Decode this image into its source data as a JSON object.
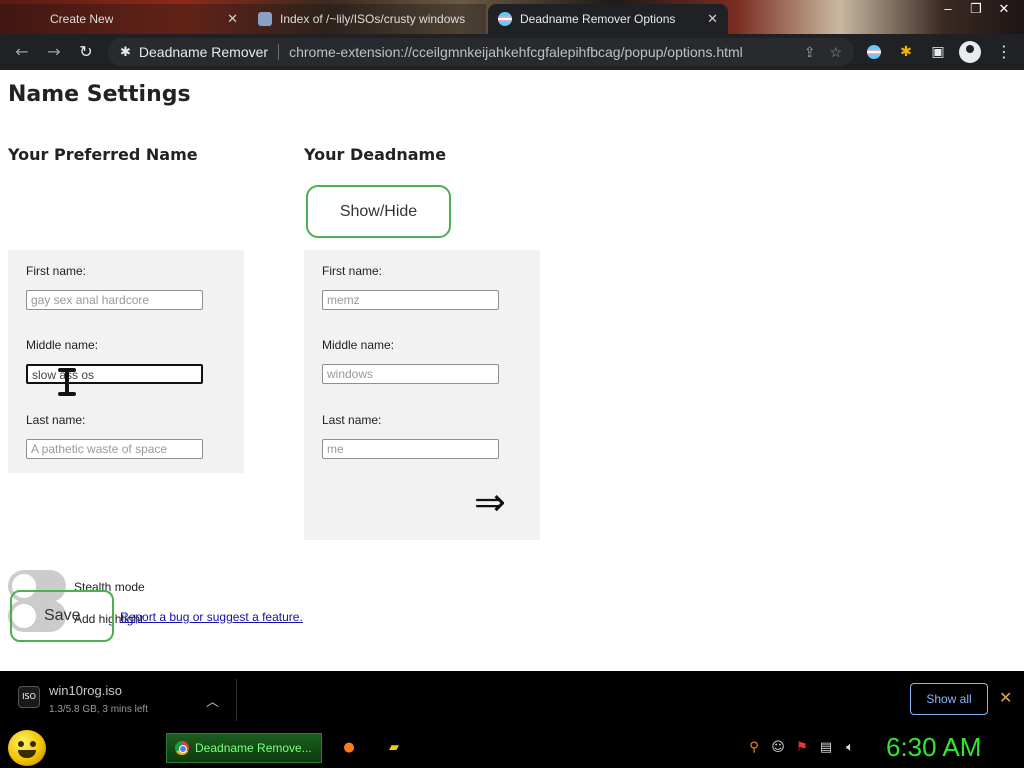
{
  "browser": {
    "tabs": [
      {
        "title": "Create New",
        "active": false
      },
      {
        "title": "Index of /~lily/ISOs/crusty windows",
        "active": false
      },
      {
        "title": "Deadname Remover Options",
        "active": true
      }
    ],
    "window_controls": {
      "minimize": "–",
      "maximize": "❐",
      "close": "✕"
    },
    "omnibox": {
      "site_name": "Deadname Remover",
      "url": "chrome-extension://cceilgmnkeijahkehfcgfalepihfbcag/popup/options.html"
    }
  },
  "page": {
    "title": "Name Settings",
    "preferred": {
      "heading": "Your Preferred Name",
      "first_label": "First name:",
      "first_value": "gay sex anal hardcore",
      "middle_label": "Middle name:",
      "middle_value": "slow ass os",
      "last_label": "Last name:",
      "last_value": "A pathetic waste of space"
    },
    "deadname": {
      "heading": "Your Deadname",
      "show_hide_label": "Show/Hide",
      "first_label": "First name:",
      "first_value": "memz",
      "middle_label": "Middle name:",
      "middle_value": "windows",
      "last_label": "Last name:",
      "last_value": "me",
      "arrow": "⇒"
    },
    "stealth_mode_label": "Stealth mode",
    "add_highlight_label": "Add highlight",
    "save_label": "Save",
    "bug_link": "Report a bug or suggest a feature."
  },
  "download_bar": {
    "file_name": "win10rog.iso",
    "status": "1.3/5.8 GB, 3 mins left",
    "file_badge": "ISO",
    "show_all": "Show all",
    "close": "✕"
  },
  "taskbar": {
    "active_window": "Deadname Remove...",
    "clock": "6:30 AM"
  },
  "colors": {
    "accent_green": "#4caf50",
    "clock_green": "#2ee82e",
    "link_blue": "#1a0dab",
    "panel_gray": "#f2f2f2"
  }
}
